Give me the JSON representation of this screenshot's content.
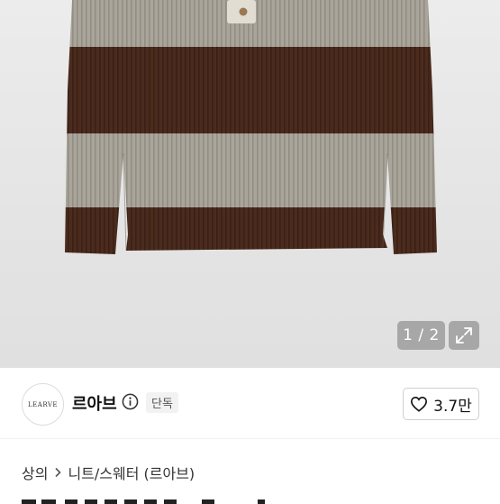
{
  "gallery": {
    "counter": "1 / 2",
    "expand_icon": "expand-icon",
    "colors": {
      "knit_beige": "#a9a49a",
      "knit_brown": "#4a2a1c",
      "background": "#e6e6e6"
    }
  },
  "store": {
    "logo_text": "LEARVE",
    "name": "르아브",
    "info_icon": "info-icon",
    "badge": "단독",
    "like_icon": "heart-icon",
    "like_count": "3.7만"
  },
  "breadcrumb": {
    "items": [
      "상의",
      "니트/스웨터 (르아브)"
    ],
    "separator_icon": "chevron-right-icon"
  }
}
